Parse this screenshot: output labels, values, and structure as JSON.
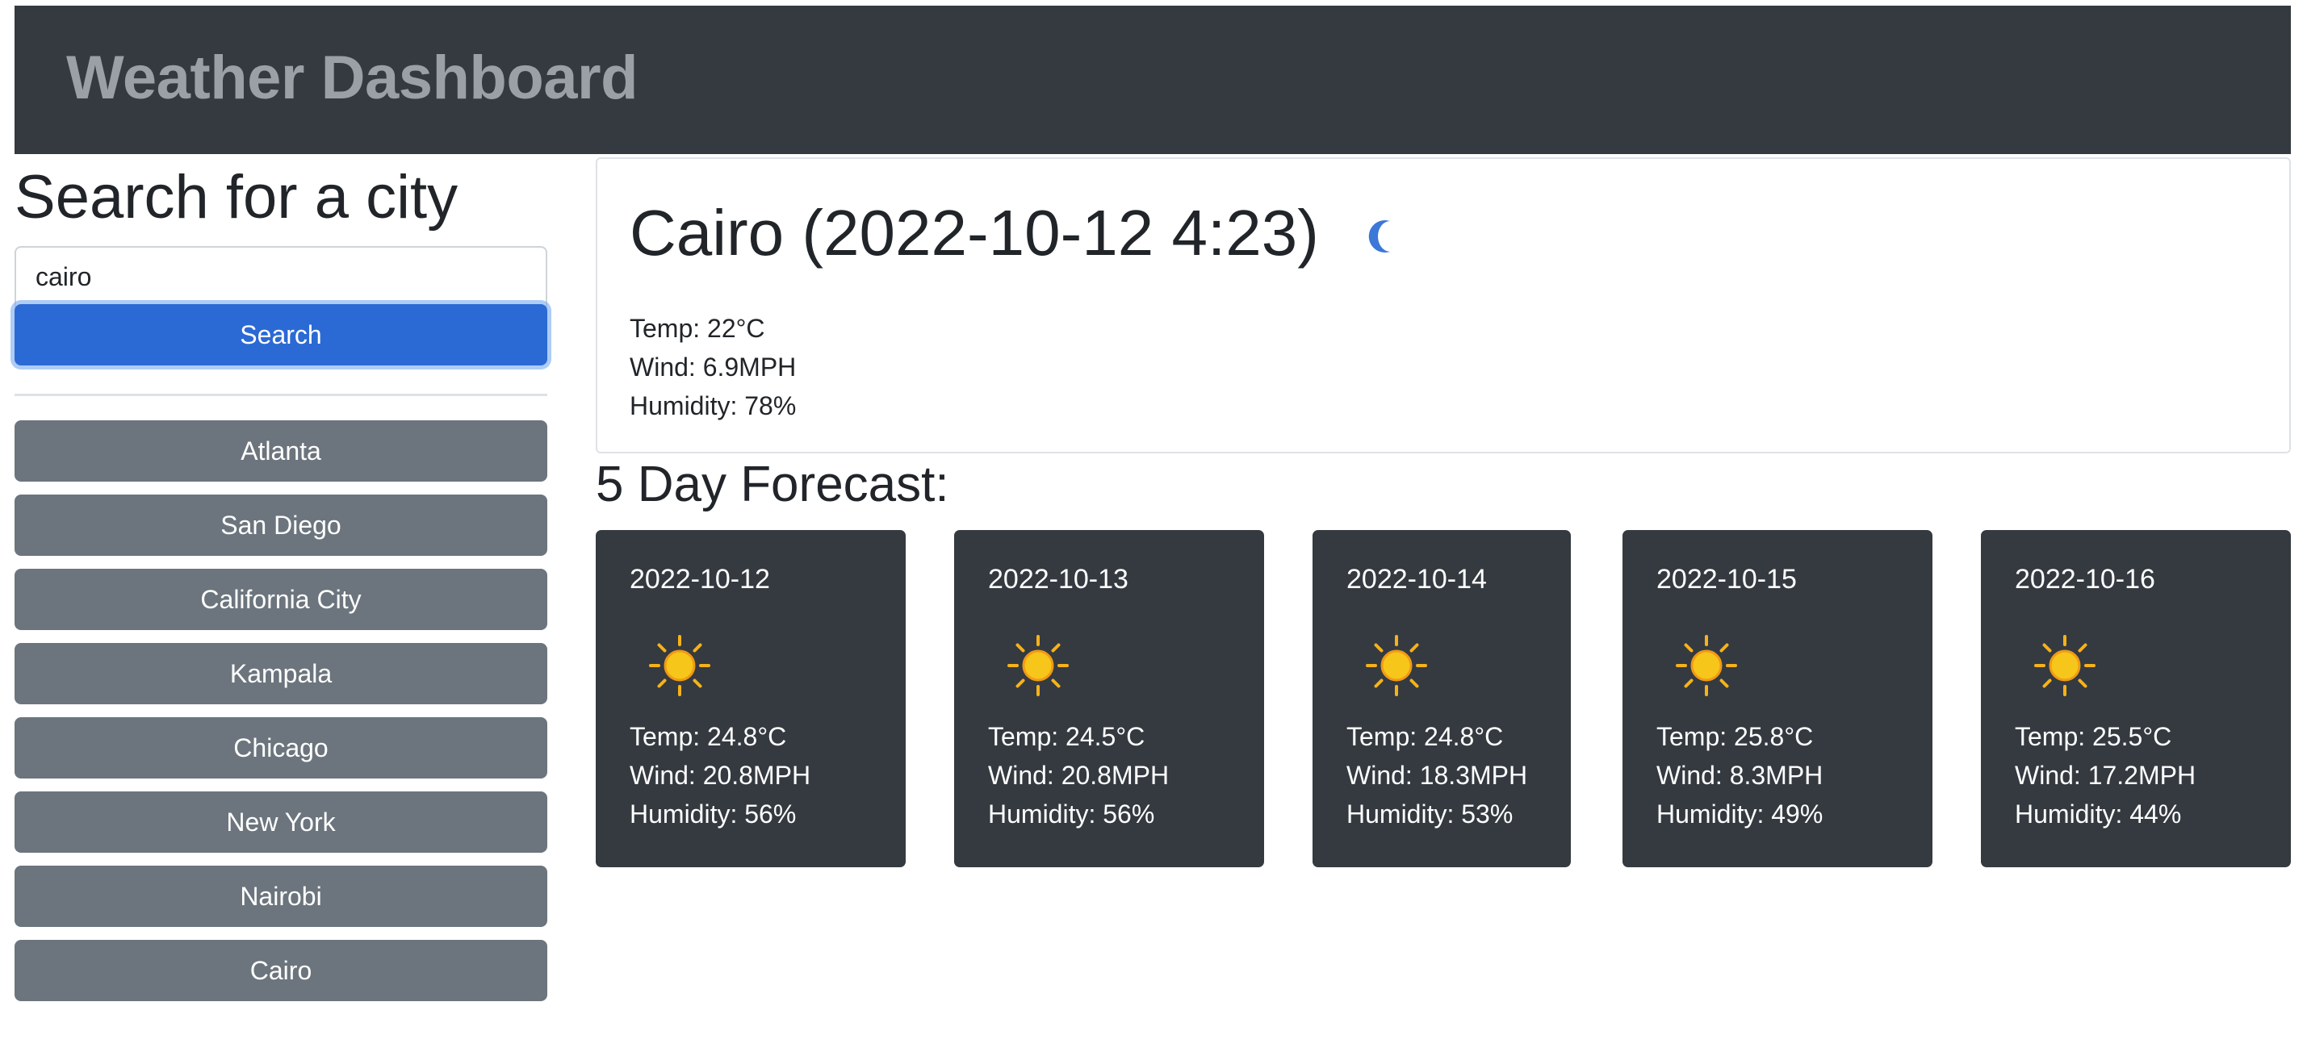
{
  "header": {
    "title": "Weather Dashboard"
  },
  "sidebar": {
    "heading": "Search for a city",
    "search_value": "cairo",
    "search_button": "Search",
    "history": [
      "Atlanta",
      "San Diego",
      "California City",
      "Kampala",
      "Chicago",
      "New York",
      "Nairobi",
      "Cairo"
    ]
  },
  "current": {
    "title": "Cairo (2022-10-12 4:23)",
    "icon": "moon-icon",
    "temp": "Temp: 22°C",
    "wind": "Wind: 6.9MPH",
    "humidity": "Humidity: 78%"
  },
  "forecast": {
    "title": "5 Day Forecast:",
    "days": [
      {
        "date": "2022-10-12",
        "icon": "sun-icon",
        "temp": "Temp: 24.8°C",
        "wind": "Wind: 20.8MPH",
        "humidity": "Humidity: 56%"
      },
      {
        "date": "2022-10-13",
        "icon": "sun-icon",
        "temp": "Temp: 24.5°C",
        "wind": "Wind: 20.8MPH",
        "humidity": "Humidity: 56%"
      },
      {
        "date": "2022-10-14",
        "icon": "sun-icon",
        "temp": "Temp: 24.8°C",
        "wind": "Wind: 18.3MPH",
        "humidity": "Humidity: 53%"
      },
      {
        "date": "2022-10-15",
        "icon": "sun-icon",
        "temp": "Temp: 25.8°C",
        "wind": "Wind: 8.3MPH",
        "humidity": "Humidity: 49%"
      },
      {
        "date": "2022-10-16",
        "icon": "sun-icon",
        "temp": "Temp: 25.5°C",
        "wind": "Wind: 17.2MPH",
        "humidity": "Humidity: 44%"
      }
    ]
  },
  "colors": {
    "header_bg": "#343a40",
    "primary": "#2b6ad4",
    "secondary": "#6c757d",
    "card_bg": "#343a40"
  }
}
